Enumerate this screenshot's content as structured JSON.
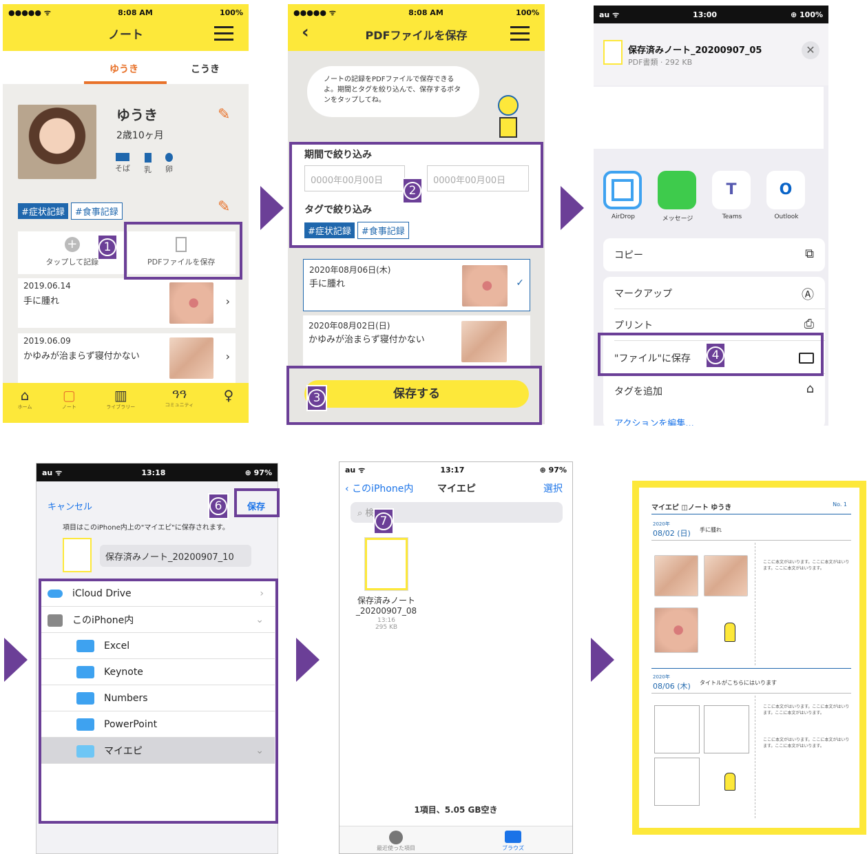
{
  "s1": {
    "status_left": "●●●●● ᯤ",
    "time": "8:08 AM",
    "battery": "100%",
    "title": "ノート",
    "tab_active": "ゆうき",
    "tab_other": "こうき",
    "child_name": "ゆうき",
    "age": "2歳10ヶ月",
    "allergies": [
      "そば",
      "乳",
      "卵"
    ],
    "tags": [
      "#症状記録",
      "#食事記録"
    ],
    "add_label": "タップして記録",
    "pdf_label": "PDFファイルを保存",
    "entries": [
      {
        "date": "2019.06.14",
        "text": "手に腫れ"
      },
      {
        "date": "2019.06.09",
        "text": "かゆみが治まらず寝付かない"
      }
    ],
    "nav": [
      "ホーム",
      "ノート",
      "ライブラリー",
      "コミュニティ",
      ""
    ]
  },
  "s2": {
    "status_left": "●●●●● ᯤ",
    "time": "8:08 AM",
    "battery": "100%",
    "title": "PDFファイルを保存",
    "bubble": "ノートの記録をPDFファイルで保存できるよ。期間とタグを絞り込んで、保存するボタンをタップしてね。",
    "period_label": "期間で絞り込み",
    "date_placeholder": "0000年00月00日",
    "tag_label": "タグで絞り込み",
    "tags": [
      "#症状記録",
      "#食事記録"
    ],
    "entries": [
      {
        "date": "2020年08月06日(木)",
        "text": "手に腫れ"
      },
      {
        "date": "2020年08月02日(日)",
        "text": "かゆみが治まらず寝付かない"
      }
    ],
    "save": "保存する",
    "check": "✓"
  },
  "s3": {
    "status_left": "au ᯤ",
    "time": "13:00",
    "battery": "⊕ 100%",
    "file_name": "保存済みノート_20200907_05",
    "file_meta": "PDF書類 · 292 KB",
    "apps": [
      "AirDrop",
      "メッセージ",
      "Teams",
      "Outlook"
    ],
    "actions": [
      "コピー",
      "マークアップ",
      "プリント",
      "\"ファイル\"に保存",
      "タグを追加"
    ],
    "edit": "アクションを編集..."
  },
  "s4": {
    "status_left": "au ᯤ",
    "time": "13:18",
    "battery": "⊕ 97%",
    "cancel": "キャンセル",
    "save": "保存",
    "note": "項目はこのiPhone内上の\"マイエピ\"に保存されます。",
    "file_name": "保存済みノート_20200907_10",
    "locations": [
      "iCloud Drive",
      "このiPhone内",
      "Excel",
      "Keynote",
      "Numbers",
      "PowerPoint",
      "マイエピ"
    ]
  },
  "s5": {
    "status_left": "au ᯤ",
    "time": "13:17",
    "battery": "⊕ 97%",
    "back": "このiPhone内",
    "title": "マイエピ",
    "select": "選択",
    "search": "検",
    "file_name_1": "保存済みノート",
    "file_name_2": "_20200907_08",
    "file_time": "13:16",
    "file_size": "295 KB",
    "footer": "1項目、5.05 GB空き",
    "tabs": [
      "最近使った項目",
      "ブラウズ"
    ]
  },
  "s6": {
    "header": "マイエピ ◫ノート ゆうき",
    "no": "No. 1",
    "d1_year": "2020年",
    "d1": "08/02 (日)",
    "d1_title": "手に腫れ",
    "d2_year": "2020年",
    "d2": "08/06 (木)",
    "d2_title": "タイトルがこちらにはいります",
    "body": "ここに本文がはいります。ここに本文がはいります。ここに本文がはいります。"
  },
  "markers": [
    "1",
    "2",
    "3",
    "4",
    "6",
    "7"
  ],
  "colors": {
    "yellow": "#fde83a",
    "purple": "#6b3f97",
    "blue": "#1f67ad"
  }
}
